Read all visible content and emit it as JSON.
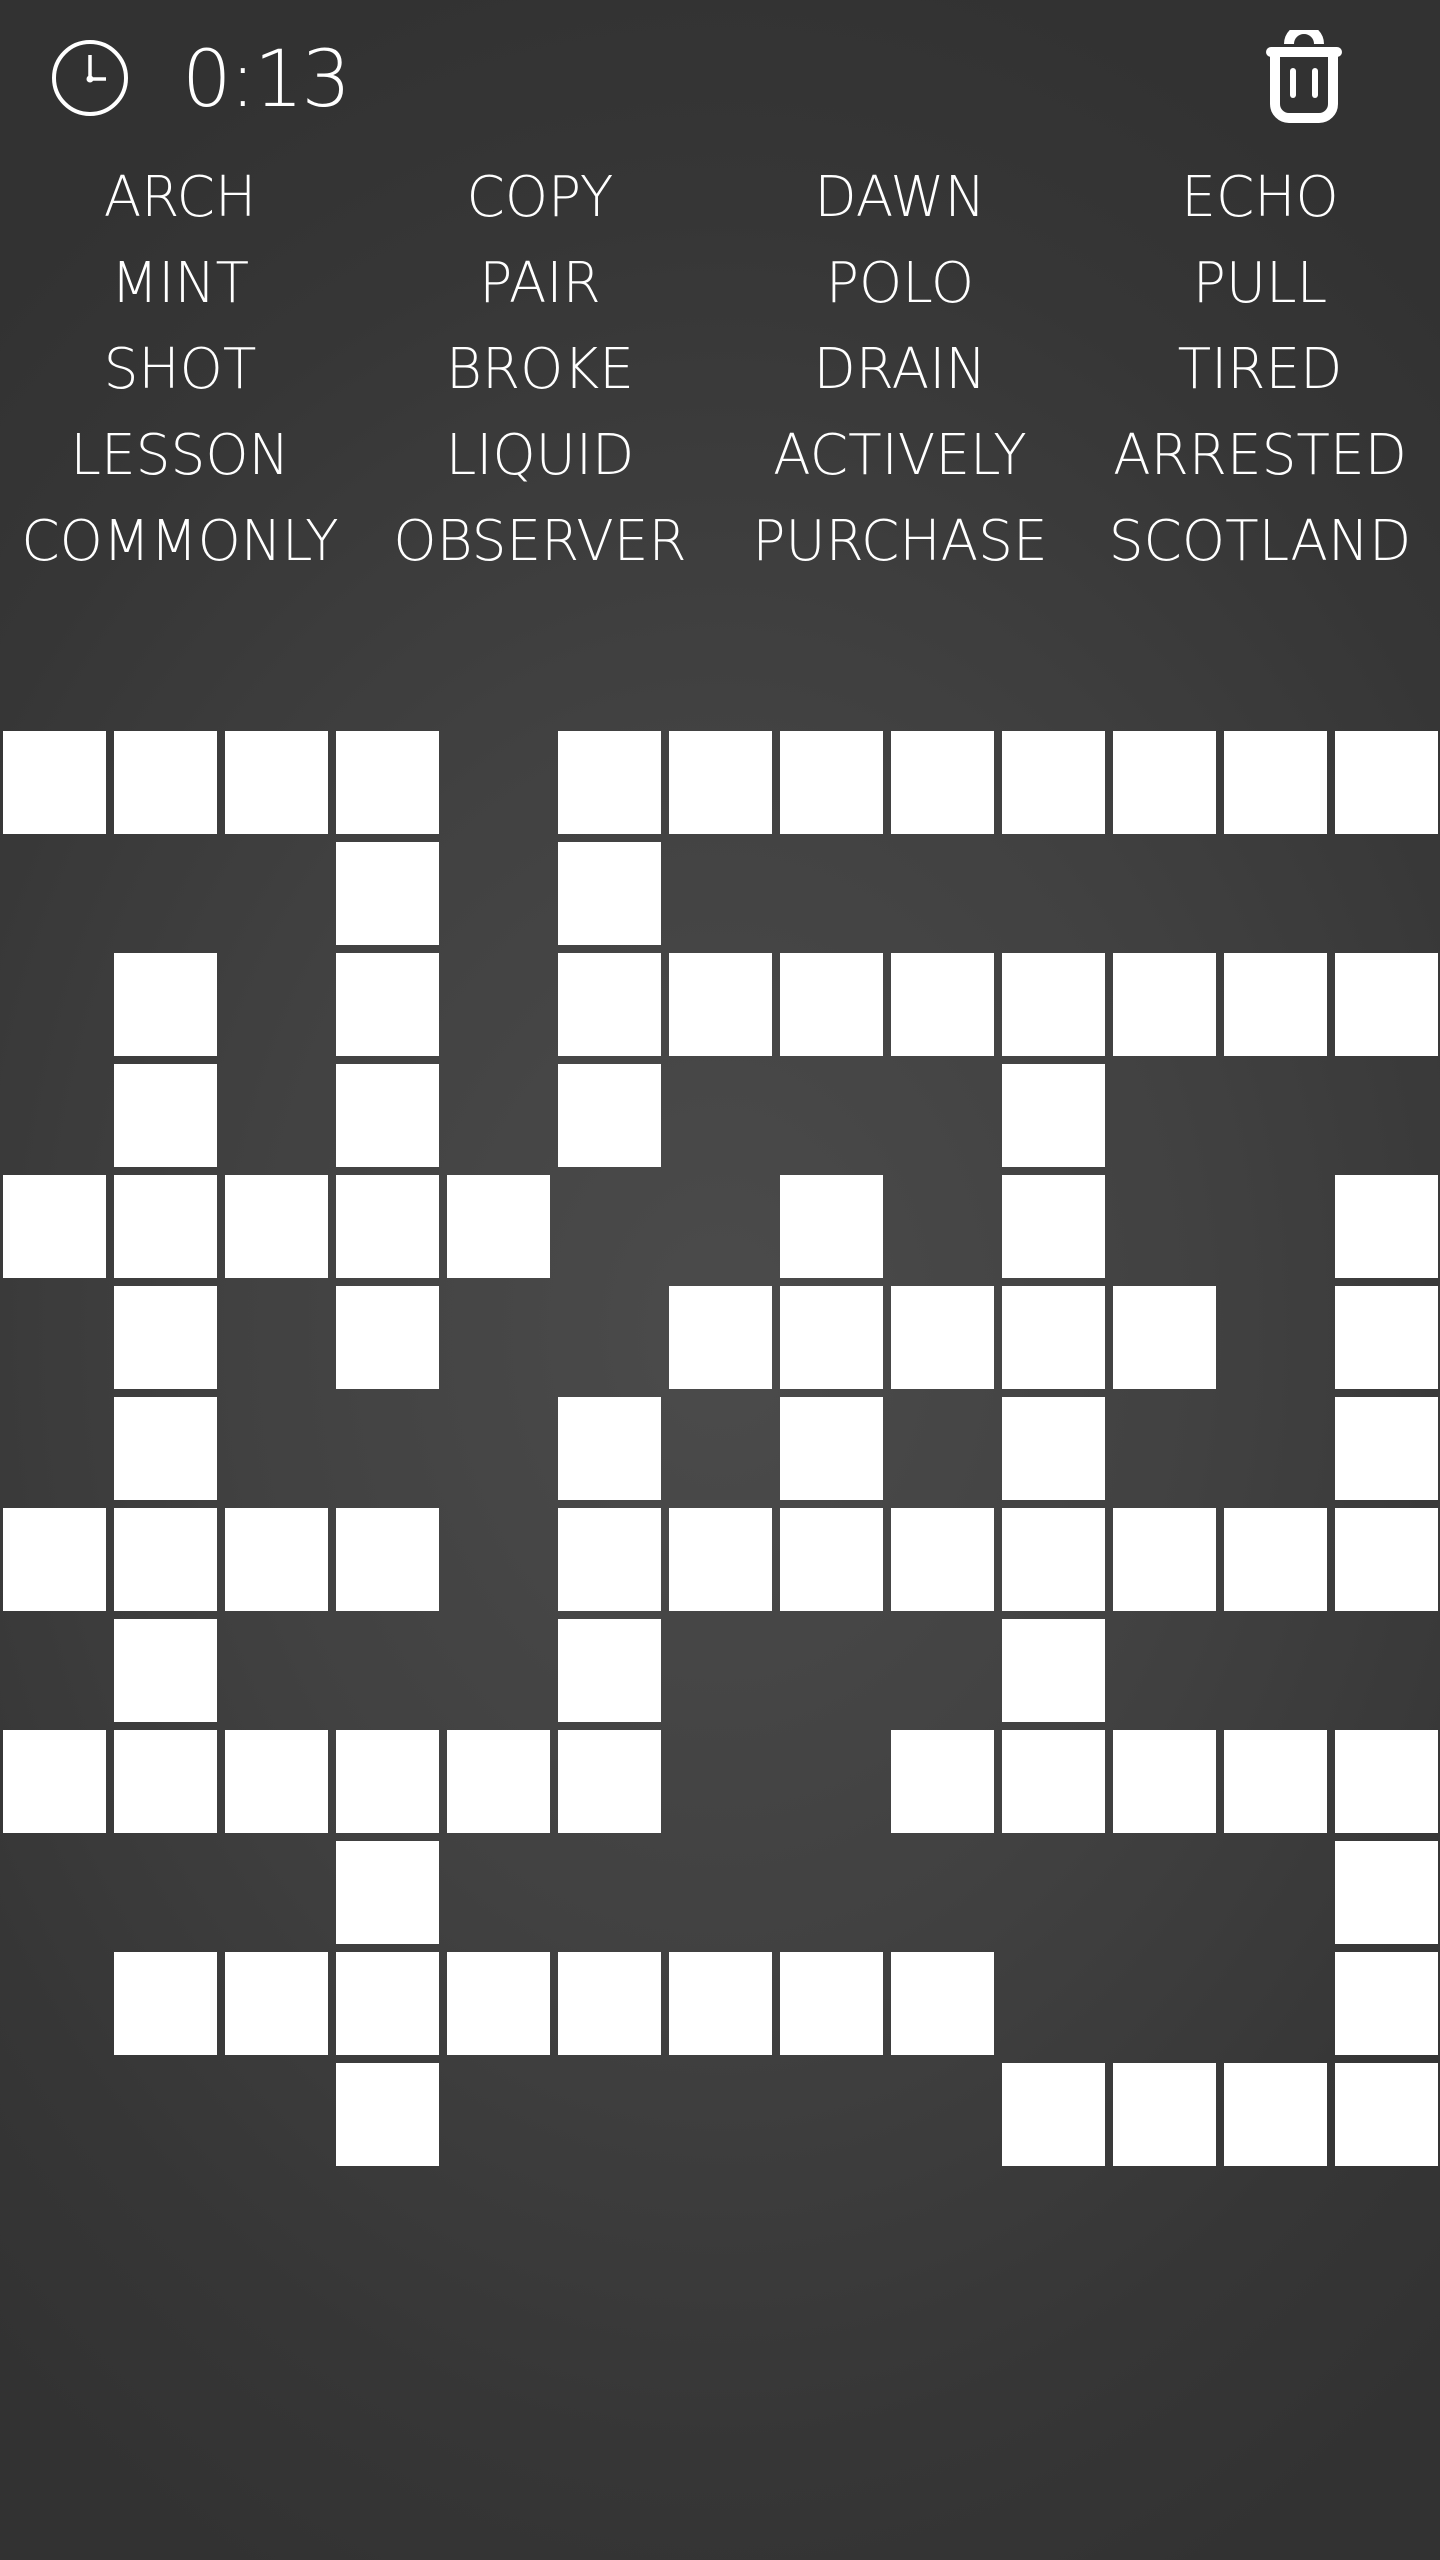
{
  "header": {
    "timer": "0:13",
    "clock_icon": "clock-icon",
    "trash_icon": "trash-icon"
  },
  "word_list": [
    "ARCH",
    "COPY",
    "DAWN",
    "ECHO",
    "MINT",
    "PAIR",
    "POLO",
    "PULL",
    "SHOT",
    "BROKE",
    "DRAIN",
    "TIRED",
    "LESSON",
    "LIQUID",
    "ACTIVELY",
    "ARRESTED",
    "COMMONLY",
    "OBSERVER",
    "PURCHASE",
    "SCOTLAND"
  ],
  "board": {
    "rows": 13,
    "cols": 13,
    "layout": [
      "1111011111111",
      "0001010000000",
      "0101011111111",
      "0101010001000",
      "1111100101001",
      "0101001111101",
      "0100010101001",
      "1111011111111",
      "0100010001000",
      "1111110011111",
      "0001000000001",
      "0111111110001",
      "0001000001111"
    ],
    "cell_color": "#ffffff"
  },
  "colors": {
    "background_center": "#4b4b4b",
    "background_edge": "#323232",
    "text": "#ffffff"
  }
}
